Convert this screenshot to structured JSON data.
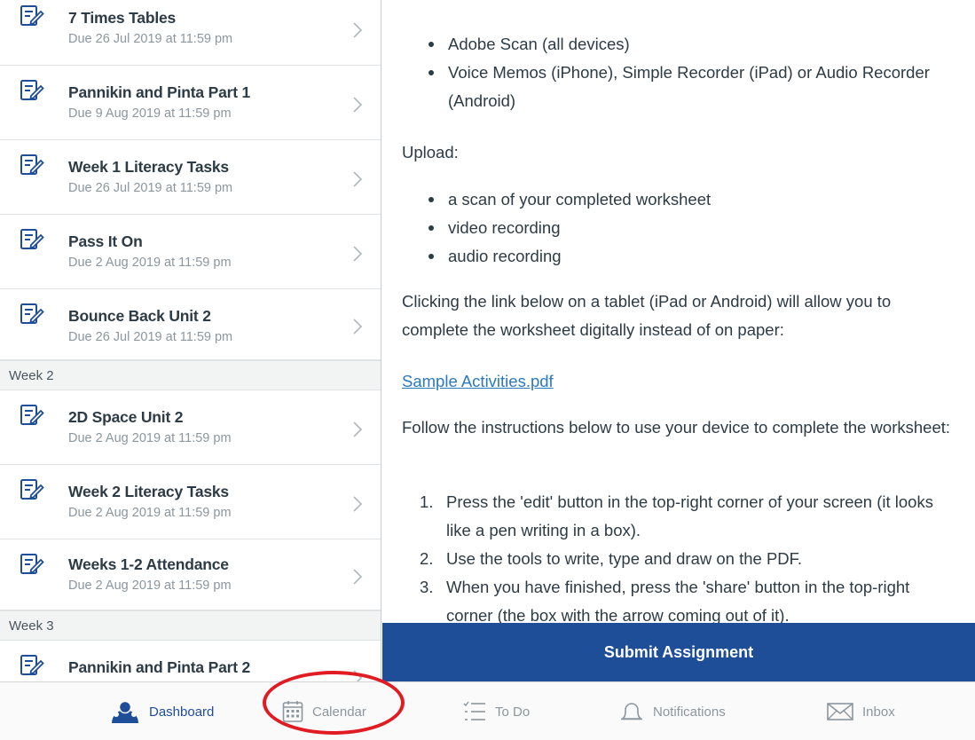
{
  "assignments": {
    "items": [
      {
        "title": "7 Times Tables",
        "due": "Due 26 Jul 2019 at 11:59 pm"
      },
      {
        "title": "Pannikin and Pinta Part 1",
        "due": "Due 9 Aug 2019 at 11:59 pm"
      },
      {
        "title": "Week 1 Literacy Tasks",
        "due": "Due 26 Jul 2019 at 11:59 pm"
      },
      {
        "title": "Pass It On",
        "due": "Due 2 Aug 2019 at 11:59 pm"
      },
      {
        "title": "Bounce Back Unit 2",
        "due": "Due 26 Jul 2019 at 11:59 pm"
      },
      {
        "title": "2D Space Unit 2",
        "due": "Due 2 Aug 2019 at 11:59 pm"
      },
      {
        "title": "Week 2 Literacy Tasks",
        "due": "Due 2 Aug 2019 at 11:59 pm"
      },
      {
        "title": "Weeks 1-2 Attendance",
        "due": "Due 2 Aug 2019 at 11:59 pm"
      },
      {
        "title": "Pannikin and Pinta Part 2",
        "due": ""
      }
    ],
    "sections": [
      "Week 2",
      "Week 3"
    ]
  },
  "content": {
    "apps": [
      "Adobe Scan (all devices)",
      "Voice Memos (iPhone), Simple Recorder (iPad) or Audio Recorder (Android)"
    ],
    "upload_heading": "Upload:",
    "upload_items": [
      "a scan of your completed worksheet",
      "video recording",
      "audio recording"
    ],
    "tablet_note": "Clicking the link below on a tablet (iPad or Android) will allow you to complete the worksheet digitally instead of on paper:",
    "link_text": "Sample Activities.pdf",
    "instructions_intro": "Follow the instructions below to use your device to complete the worksheet:",
    "steps": [
      "Press the 'edit' button in the top-right corner of your screen (it looks like a pen writing in a box).",
      "Use the tools to write, type and draw on the PDF.",
      "When you have finished, press the 'share' button in the top-right corner (the box with the arrow coming out of it)."
    ],
    "step_numbers": [
      "1.",
      "2.",
      "3."
    ]
  },
  "submit_label": "Submit Assignment",
  "tabs": {
    "dashboard": "Dashboard",
    "calendar": "Calendar",
    "todo": "To Do",
    "notifications": "Notifications",
    "inbox": "Inbox"
  },
  "colors": {
    "brand": "#1f4e99",
    "link": "#2b7abc",
    "highlight": "#e01b22"
  }
}
